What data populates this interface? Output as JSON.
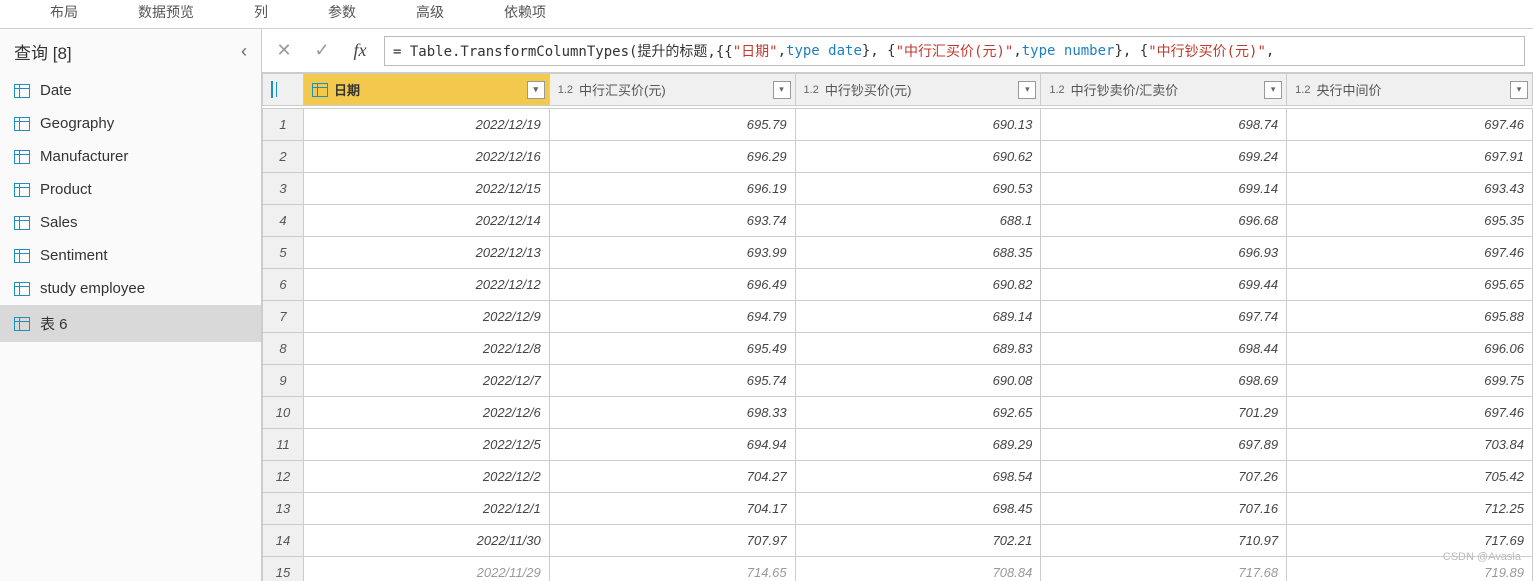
{
  "ribbon": [
    "布局",
    "数据预览",
    "列",
    "参数",
    "高级",
    "依赖项"
  ],
  "sidebar": {
    "title": "查询 [8]",
    "items": [
      "Date",
      "Geography",
      "Manufacturer",
      "Product",
      "Sales",
      "Sentiment",
      "study employee",
      "表 6"
    ]
  },
  "formula": {
    "p0": "= Table.TransformColumnTypes(提升的标题,{{",
    "p1": "\"日期\"",
    "p2": ", ",
    "p3": "type date",
    "p4": "}, {",
    "p5": "\"中行汇买价(元)\"",
    "p6": ", ",
    "p7": "type number",
    "p8": "}, {",
    "p9": "\"中行钞买价(元)\"",
    "p10": ","
  },
  "grid": {
    "typePrefix": "1.2",
    "columns": [
      "日期",
      "中行汇买价(元)",
      "中行钞买价(元)",
      "中行钞卖价/汇卖价",
      "央行中间价"
    ],
    "rows": [
      [
        "2022/12/19",
        "695.79",
        "690.13",
        "698.74",
        "697.46"
      ],
      [
        "2022/12/16",
        "696.29",
        "690.62",
        "699.24",
        "697.91"
      ],
      [
        "2022/12/15",
        "696.19",
        "690.53",
        "699.14",
        "693.43"
      ],
      [
        "2022/12/14",
        "693.74",
        "688.1",
        "696.68",
        "695.35"
      ],
      [
        "2022/12/13",
        "693.99",
        "688.35",
        "696.93",
        "697.46"
      ],
      [
        "2022/12/12",
        "696.49",
        "690.82",
        "699.44",
        "695.65"
      ],
      [
        "2022/12/9",
        "694.79",
        "689.14",
        "697.74",
        "695.88"
      ],
      [
        "2022/12/8",
        "695.49",
        "689.83",
        "698.44",
        "696.06"
      ],
      [
        "2022/12/7",
        "695.74",
        "690.08",
        "698.69",
        "699.75"
      ],
      [
        "2022/12/6",
        "698.33",
        "692.65",
        "701.29",
        "697.46"
      ],
      [
        "2022/12/5",
        "694.94",
        "689.29",
        "697.89",
        "703.84"
      ],
      [
        "2022/12/2",
        "704.27",
        "698.54",
        "707.26",
        "705.42"
      ],
      [
        "2022/12/1",
        "704.17",
        "698.45",
        "707.16",
        "712.25"
      ],
      [
        "2022/11/30",
        "707.97",
        "702.21",
        "710.97",
        "717.69"
      ],
      [
        "2022/11/29",
        "714.65",
        "708.84",
        "717.68",
        "719.89"
      ]
    ]
  },
  "watermark": "CSDN @Avasla"
}
